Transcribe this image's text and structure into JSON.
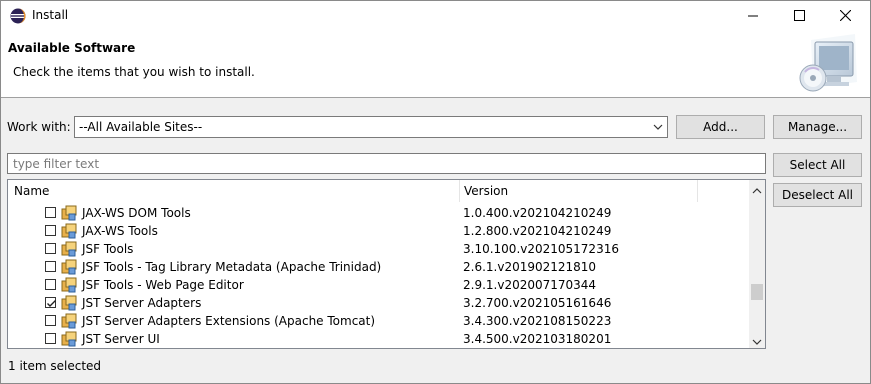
{
  "window": {
    "title": "Install"
  },
  "header": {
    "title": "Available Software",
    "description": "Check the items that you wish to install."
  },
  "work_with": {
    "label": "Work with:",
    "value": "--All Available Sites--",
    "add_label": "Add...",
    "manage_label": "Manage..."
  },
  "filter": {
    "placeholder": "type filter text"
  },
  "buttons": {
    "select_all": "Select All",
    "deselect_all": "Deselect All"
  },
  "table": {
    "columns": {
      "name": "Name",
      "version": "Version"
    },
    "rows": [
      {
        "name": "JAX-WS DOM Tools",
        "version": "1.0.400.v202104210249",
        "checked": false
      },
      {
        "name": "JAX-WS Tools",
        "version": "1.2.800.v202104210249",
        "checked": false
      },
      {
        "name": "JSF Tools",
        "version": "3.10.100.v202105172316",
        "checked": false
      },
      {
        "name": "JSF Tools - Tag Library Metadata (Apache Trinidad)",
        "version": "2.6.1.v201902121810",
        "checked": false
      },
      {
        "name": "JSF Tools - Web Page Editor",
        "version": "2.9.1.v202007170344",
        "checked": false
      },
      {
        "name": "JST Server Adapters",
        "version": "3.2.700.v202105161646",
        "checked": true
      },
      {
        "name": "JST Server Adapters Extensions (Apache Tomcat)",
        "version": "3.4.300.v202108150223",
        "checked": false
      },
      {
        "name": "JST Server UI",
        "version": "3.4.500.v202103180201",
        "checked": false
      }
    ]
  },
  "status": "1 item selected"
}
